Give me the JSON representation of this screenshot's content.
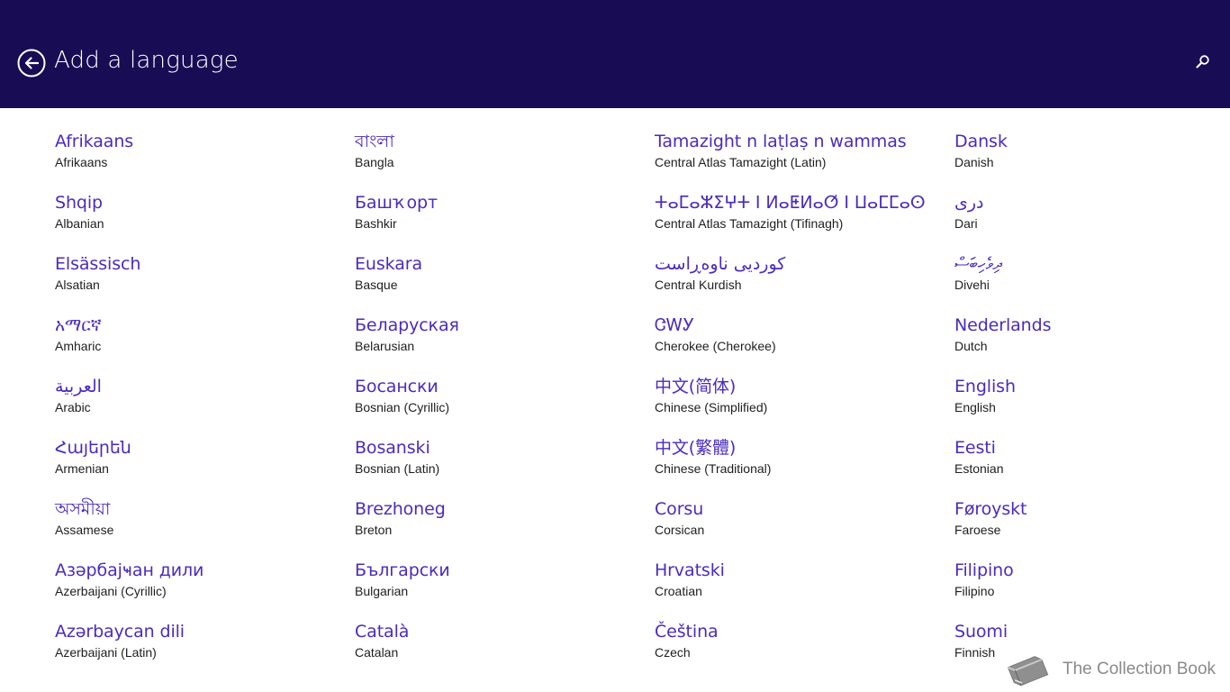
{
  "header": {
    "title": "Add a language",
    "back_icon": "back-arrow-circle-icon",
    "search_icon": "search-icon",
    "background_color": "#180c54"
  },
  "languages": {
    "columns": [
      [
        {
          "native": "Afrikaans",
          "english": "Afrikaans"
        },
        {
          "native": "Shqip",
          "english": "Albanian"
        },
        {
          "native": "Elsässisch",
          "english": "Alsatian"
        },
        {
          "native": "አማርኛ",
          "english": "Amharic"
        },
        {
          "native": "العربية",
          "english": "Arabic"
        },
        {
          "native": "Հայերեն",
          "english": "Armenian"
        },
        {
          "native": "অসমীয়া",
          "english": "Assamese"
        },
        {
          "native": "Азәрбајҹан дили",
          "english": "Azerbaijani (Cyrillic)"
        },
        {
          "native": "Azərbaycan dili",
          "english": "Azerbaijani (Latin)"
        }
      ],
      [
        {
          "native": "বাংলা",
          "english": "Bangla"
        },
        {
          "native": "Башҡорт",
          "english": "Bashkir"
        },
        {
          "native": "Euskara",
          "english": "Basque"
        },
        {
          "native": "Беларуская",
          "english": "Belarusian"
        },
        {
          "native": "Босански",
          "english": "Bosnian (Cyrillic)"
        },
        {
          "native": "Bosanski",
          "english": "Bosnian (Latin)"
        },
        {
          "native": "Brezhoneg",
          "english": "Breton"
        },
        {
          "native": "Български",
          "english": "Bulgarian"
        },
        {
          "native": "Català",
          "english": "Catalan"
        }
      ],
      [
        {
          "native": "Tamazight n laṭlaṣ n wammas",
          "english": "Central Atlas Tamazight (Latin)"
        },
        {
          "native": "ⵜⴰⵎⴰⵣⵉⵖⵜ ⵏ ⵍⴰⵟⵍⴰⵚ ⵏ ⵡⴰⵎⵎⴰⵙ",
          "english": "Central Atlas Tamazight (Tifinagh)"
        },
        {
          "native": "کوردیی ناوەڕاست",
          "english": "Central Kurdish"
        },
        {
          "native": "ᏣᎳᎩ",
          "english": "Cherokee (Cherokee)"
        },
        {
          "native": "中文(简体)",
          "english": "Chinese (Simplified)"
        },
        {
          "native": "中文(繁體)",
          "english": "Chinese (Traditional)"
        },
        {
          "native": "Corsu",
          "english": "Corsican"
        },
        {
          "native": "Hrvatski",
          "english": "Croatian"
        },
        {
          "native": "Čeština",
          "english": "Czech"
        }
      ],
      [
        {
          "native": "Dansk",
          "english": "Danish"
        },
        {
          "native": "دری",
          "english": "Dari"
        },
        {
          "native": "ދިވެހިބަސް",
          "english": "Divehi"
        },
        {
          "native": "Nederlands",
          "english": "Dutch"
        },
        {
          "native": "English",
          "english": "English"
        },
        {
          "native": "Eesti",
          "english": "Estonian"
        },
        {
          "native": "Føroyskt",
          "english": "Faroese"
        },
        {
          "native": "Filipino",
          "english": "Filipino"
        },
        {
          "native": "Suomi",
          "english": "Finnish"
        }
      ]
    ],
    "native_color": "#4b2bbd",
    "english_color": "#1e1e1e"
  },
  "watermark": {
    "text": "The Collection Book",
    "icon": "book-icon"
  }
}
